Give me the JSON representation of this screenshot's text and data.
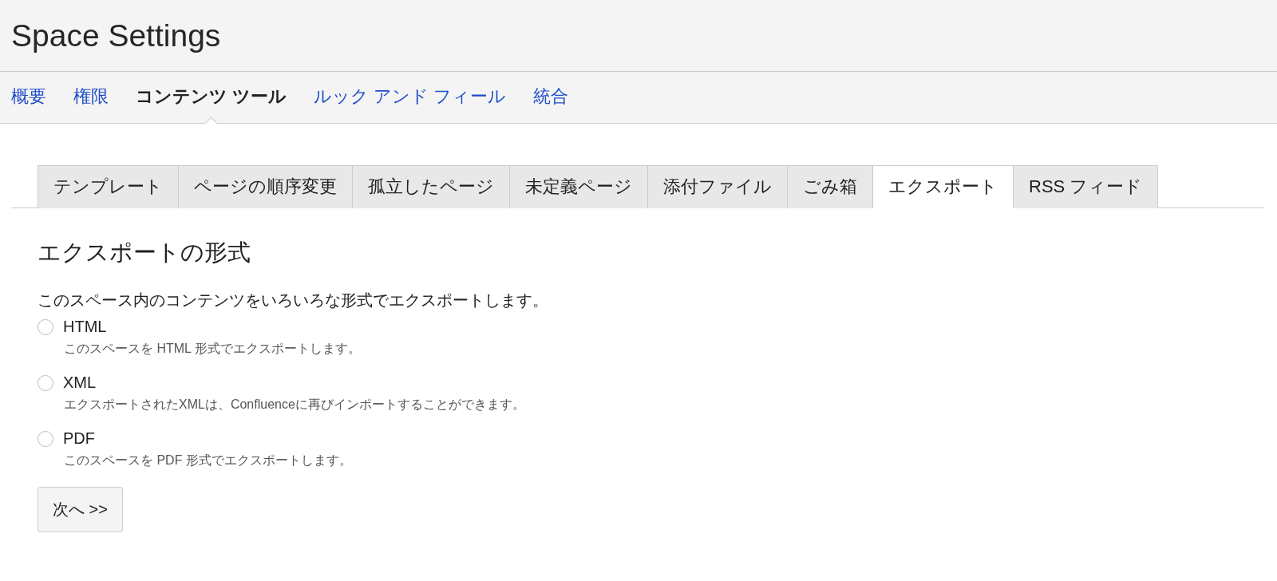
{
  "header": {
    "title": "Space Settings"
  },
  "nav": [
    {
      "label": "概要",
      "selected": false
    },
    {
      "label": "権限",
      "selected": false
    },
    {
      "label": "コンテンツ ツール",
      "selected": true
    },
    {
      "label": "ルック アンド フィール",
      "selected": false
    },
    {
      "label": "統合",
      "selected": false
    }
  ],
  "tabs": [
    {
      "label": "テンプレート",
      "selected": false
    },
    {
      "label": "ページの順序変更",
      "selected": false
    },
    {
      "label": "孤立したページ",
      "selected": false
    },
    {
      "label": "未定義ページ",
      "selected": false
    },
    {
      "label": "添付ファイル",
      "selected": false
    },
    {
      "label": "ごみ箱",
      "selected": false
    },
    {
      "label": "エクスポート",
      "selected": true
    },
    {
      "label": "RSS フィード",
      "selected": false
    }
  ],
  "export": {
    "heading": "エクスポートの形式",
    "intro": "このスペース内のコンテンツをいろいろな形式でエクスポートします。",
    "options": [
      {
        "label": "HTML",
        "description": "このスペースを HTML 形式でエクスポートします。",
        "selected": false
      },
      {
        "label": "XML",
        "description": "エクスポートされたXMLは、Confluenceに再びインポートすることができます。",
        "selected": false
      },
      {
        "label": "PDF",
        "description": "このスペースを PDF 形式でエクスポートします。",
        "selected": false
      }
    ],
    "next_button": "次へ >>"
  }
}
